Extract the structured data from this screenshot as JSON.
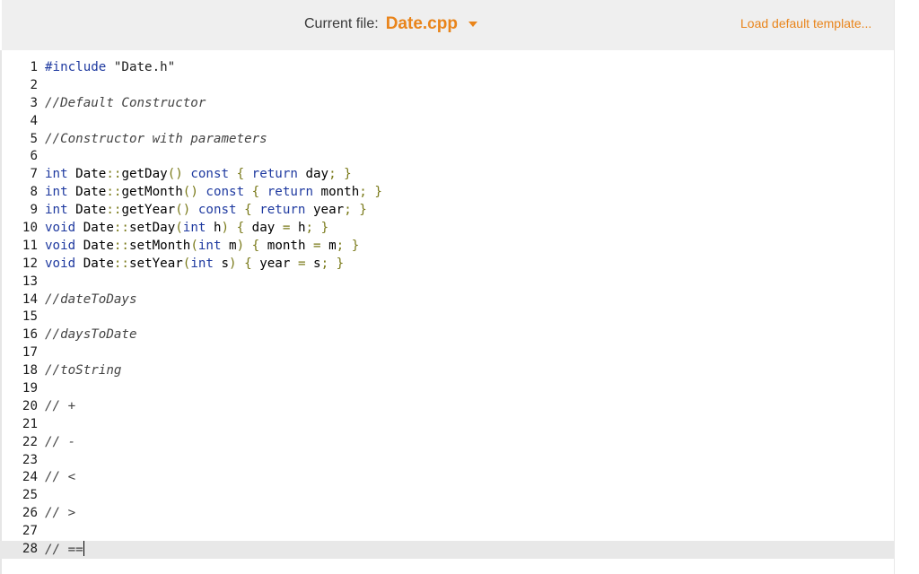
{
  "header": {
    "file_label": "Current file:",
    "file_name": "Date.cpp",
    "load_default": "Load default template..."
  },
  "editor": {
    "active_line": 28,
    "lines": [
      {
        "n": "1",
        "tokens": [
          {
            "t": "#include ",
            "c": "kw"
          },
          {
            "t": "\"Date.h\"",
            "c": "str"
          }
        ]
      },
      {
        "n": "2",
        "tokens": []
      },
      {
        "n": "3",
        "tokens": [
          {
            "t": "//Default Constructor",
            "c": "cm"
          }
        ]
      },
      {
        "n": "4",
        "tokens": []
      },
      {
        "n": "5",
        "tokens": [
          {
            "t": "//Constructor with parameters",
            "c": "cm"
          }
        ]
      },
      {
        "n": "6",
        "tokens": []
      },
      {
        "n": "7",
        "tokens": [
          {
            "t": "int",
            "c": "kw"
          },
          {
            "t": " Date",
            "c": "fn"
          },
          {
            "t": "::",
            "c": "op"
          },
          {
            "t": "getDay",
            "c": "fn"
          },
          {
            "t": "()",
            "c": "pn"
          },
          {
            "t": " const ",
            "c": "kw"
          },
          {
            "t": "{",
            "c": "pn"
          },
          {
            "t": " return",
            "c": "kw"
          },
          {
            "t": " day",
            "c": "fn"
          },
          {
            "t": ";",
            "c": "op"
          },
          {
            "t": " }",
            "c": "pn"
          }
        ]
      },
      {
        "n": "8",
        "tokens": [
          {
            "t": "int",
            "c": "kw"
          },
          {
            "t": " Date",
            "c": "fn"
          },
          {
            "t": "::",
            "c": "op"
          },
          {
            "t": "getMonth",
            "c": "fn"
          },
          {
            "t": "()",
            "c": "pn"
          },
          {
            "t": " const ",
            "c": "kw"
          },
          {
            "t": "{",
            "c": "pn"
          },
          {
            "t": " return",
            "c": "kw"
          },
          {
            "t": " month",
            "c": "fn"
          },
          {
            "t": ";",
            "c": "op"
          },
          {
            "t": " }",
            "c": "pn"
          }
        ]
      },
      {
        "n": "9",
        "tokens": [
          {
            "t": "int",
            "c": "kw"
          },
          {
            "t": " Date",
            "c": "fn"
          },
          {
            "t": "::",
            "c": "op"
          },
          {
            "t": "getYear",
            "c": "fn"
          },
          {
            "t": "()",
            "c": "pn"
          },
          {
            "t": " const ",
            "c": "kw"
          },
          {
            "t": "{",
            "c": "pn"
          },
          {
            "t": " return",
            "c": "kw"
          },
          {
            "t": " year",
            "c": "fn"
          },
          {
            "t": ";",
            "c": "op"
          },
          {
            "t": " }",
            "c": "pn"
          }
        ]
      },
      {
        "n": "10",
        "tokens": [
          {
            "t": "void",
            "c": "kw"
          },
          {
            "t": " Date",
            "c": "fn"
          },
          {
            "t": "::",
            "c": "op"
          },
          {
            "t": "setDay",
            "c": "fn"
          },
          {
            "t": "(",
            "c": "pn"
          },
          {
            "t": "int",
            "c": "kw"
          },
          {
            "t": " h",
            "c": "fn"
          },
          {
            "t": ")",
            "c": "pn"
          },
          {
            "t": " {",
            "c": "pn"
          },
          {
            "t": " day ",
            "c": "fn"
          },
          {
            "t": "=",
            "c": "op"
          },
          {
            "t": " h",
            "c": "fn"
          },
          {
            "t": ";",
            "c": "op"
          },
          {
            "t": " }",
            "c": "pn"
          }
        ]
      },
      {
        "n": "11",
        "tokens": [
          {
            "t": "void",
            "c": "kw"
          },
          {
            "t": " Date",
            "c": "fn"
          },
          {
            "t": "::",
            "c": "op"
          },
          {
            "t": "setMonth",
            "c": "fn"
          },
          {
            "t": "(",
            "c": "pn"
          },
          {
            "t": "int",
            "c": "kw"
          },
          {
            "t": " m",
            "c": "fn"
          },
          {
            "t": ")",
            "c": "pn"
          },
          {
            "t": " {",
            "c": "pn"
          },
          {
            "t": " month ",
            "c": "fn"
          },
          {
            "t": "=",
            "c": "op"
          },
          {
            "t": " m",
            "c": "fn"
          },
          {
            "t": ";",
            "c": "op"
          },
          {
            "t": " }",
            "c": "pn"
          }
        ]
      },
      {
        "n": "12",
        "tokens": [
          {
            "t": "void",
            "c": "kw"
          },
          {
            "t": " Date",
            "c": "fn"
          },
          {
            "t": "::",
            "c": "op"
          },
          {
            "t": "setYear",
            "c": "fn"
          },
          {
            "t": "(",
            "c": "pn"
          },
          {
            "t": "int",
            "c": "kw"
          },
          {
            "t": " s",
            "c": "fn"
          },
          {
            "t": ")",
            "c": "pn"
          },
          {
            "t": " {",
            "c": "pn"
          },
          {
            "t": " year ",
            "c": "fn"
          },
          {
            "t": "=",
            "c": "op"
          },
          {
            "t": " s",
            "c": "fn"
          },
          {
            "t": ";",
            "c": "op"
          },
          {
            "t": " }",
            "c": "pn"
          }
        ]
      },
      {
        "n": "13",
        "tokens": []
      },
      {
        "n": "14",
        "tokens": [
          {
            "t": "//dateToDays",
            "c": "cm"
          }
        ]
      },
      {
        "n": "15",
        "tokens": []
      },
      {
        "n": "16",
        "tokens": [
          {
            "t": "//daysToDate",
            "c": "cm"
          }
        ]
      },
      {
        "n": "17",
        "tokens": []
      },
      {
        "n": "18",
        "tokens": [
          {
            "t": "//toString",
            "c": "cm"
          }
        ]
      },
      {
        "n": "19",
        "tokens": []
      },
      {
        "n": "20",
        "tokens": [
          {
            "t": "// +",
            "c": "cm"
          }
        ]
      },
      {
        "n": "21",
        "tokens": []
      },
      {
        "n": "22",
        "tokens": [
          {
            "t": "// -",
            "c": "cm"
          }
        ]
      },
      {
        "n": "23",
        "tokens": []
      },
      {
        "n": "24",
        "tokens": [
          {
            "t": "// <",
            "c": "cm"
          }
        ]
      },
      {
        "n": "25",
        "tokens": []
      },
      {
        "n": "26",
        "tokens": [
          {
            "t": "// >",
            "c": "cm"
          }
        ]
      },
      {
        "n": "27",
        "tokens": []
      },
      {
        "n": "28",
        "tokens": [
          {
            "t": "// ==",
            "c": "cm"
          }
        ]
      }
    ]
  }
}
